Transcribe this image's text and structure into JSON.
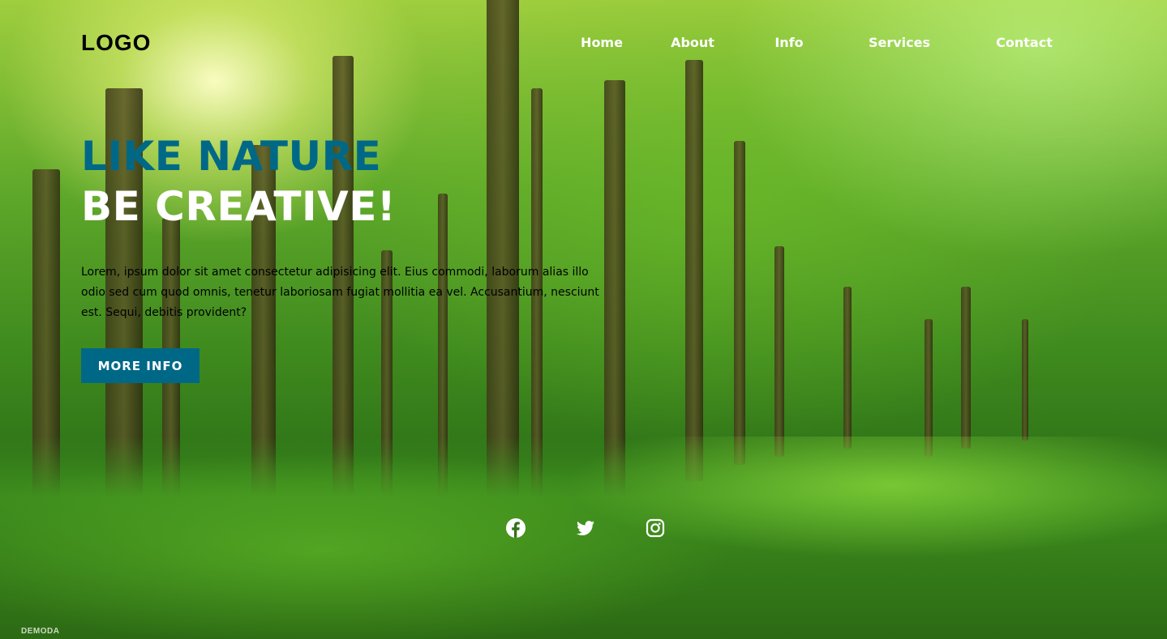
{
  "header": {
    "logo": "LOGO",
    "nav": [
      "Home",
      "About",
      "Info",
      "Services",
      "Contact"
    ]
  },
  "hero": {
    "title_line1": "LIKE NATURE",
    "title_line2": "BE CREATIVE!",
    "description": "Lorem, ipsum dolor sit amet consectetur adipisicing elit. Eius commodi, laborum alias illo odio sed cum quod omnis, tenetur laboriosam fugiat mollitia ea vel. Accusantium, nesciunt est. Sequi, debitis provident?",
    "button_label": "MORE INFO"
  },
  "social": {
    "icons": [
      "facebook-icon",
      "twitter-icon",
      "instagram-icon"
    ]
  },
  "watermark": "DEMODA",
  "colors": {
    "accent": "#006887",
    "nav_text": "#ffffff",
    "logo_text": "#000000"
  }
}
